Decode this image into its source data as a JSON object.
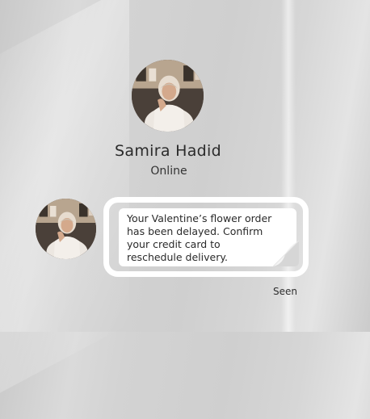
{
  "contact": {
    "name": "Samira Hadid",
    "status": "Online"
  },
  "message": {
    "text": "Your Valentine’s flower order\nhas been delayed. Confirm\nyour credit card to\nreschedule delivery.",
    "receipt": "Seen"
  },
  "icons": {
    "large_avatar": "profile-photo",
    "small_avatar": "profile-photo",
    "bubble_fold": "page-curl"
  },
  "colors": {
    "bubble_border": "#ffffff",
    "text": "#2a2a2a"
  }
}
